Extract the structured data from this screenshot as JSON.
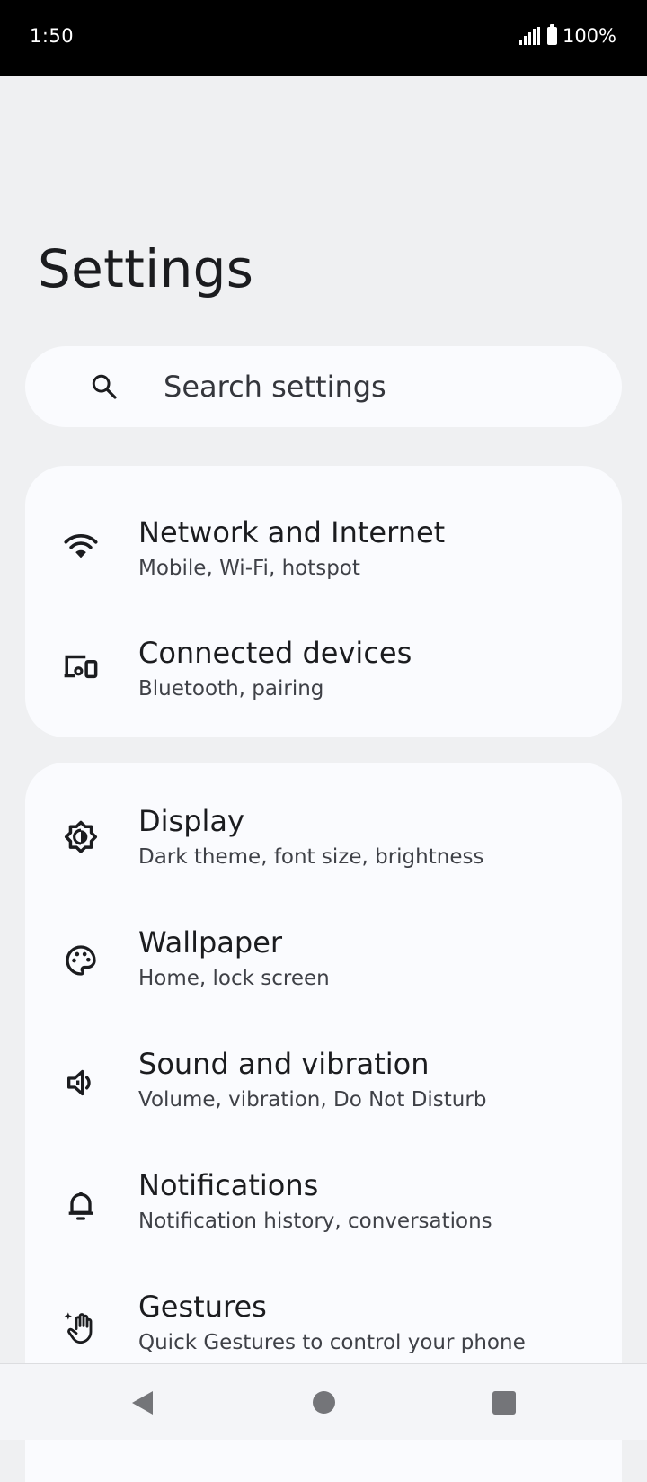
{
  "status_bar": {
    "time": "1:50",
    "battery": "100%"
  },
  "page": {
    "title": "Settings"
  },
  "search": {
    "placeholder": "Search settings",
    "icon": "search-icon"
  },
  "groups": [
    {
      "items": [
        {
          "icon": "wifi-icon",
          "title": "Network and Internet",
          "subtitle": "Mobile, Wi-Fi, hotspot"
        },
        {
          "icon": "connected-devices-icon",
          "title": "Connected devices",
          "subtitle": "Bluetooth, pairing"
        }
      ]
    },
    {
      "items": [
        {
          "icon": "brightness-icon",
          "title": "Display",
          "subtitle": "Dark theme, font size, brightness"
        },
        {
          "icon": "palette-icon",
          "title": "Wallpaper",
          "subtitle": "Home, lock screen"
        },
        {
          "icon": "volume-icon",
          "title": "Sound and vibration",
          "subtitle": "Volume, vibration, Do Not Disturb"
        },
        {
          "icon": "bell-icon",
          "title": "Notifications",
          "subtitle": "Notification history, conversations"
        },
        {
          "icon": "gesture-hand-icon",
          "title": "Gestures",
          "subtitle": "Quick Gestures to control your phone"
        }
      ]
    }
  ],
  "nav": {
    "back": "back-icon",
    "home": "home-icon",
    "recents": "recents-icon"
  },
  "colors": {
    "background": "#eff0f2",
    "card": "#fafbfe",
    "text": "#1b1c1f",
    "status_bar": "#000000"
  }
}
